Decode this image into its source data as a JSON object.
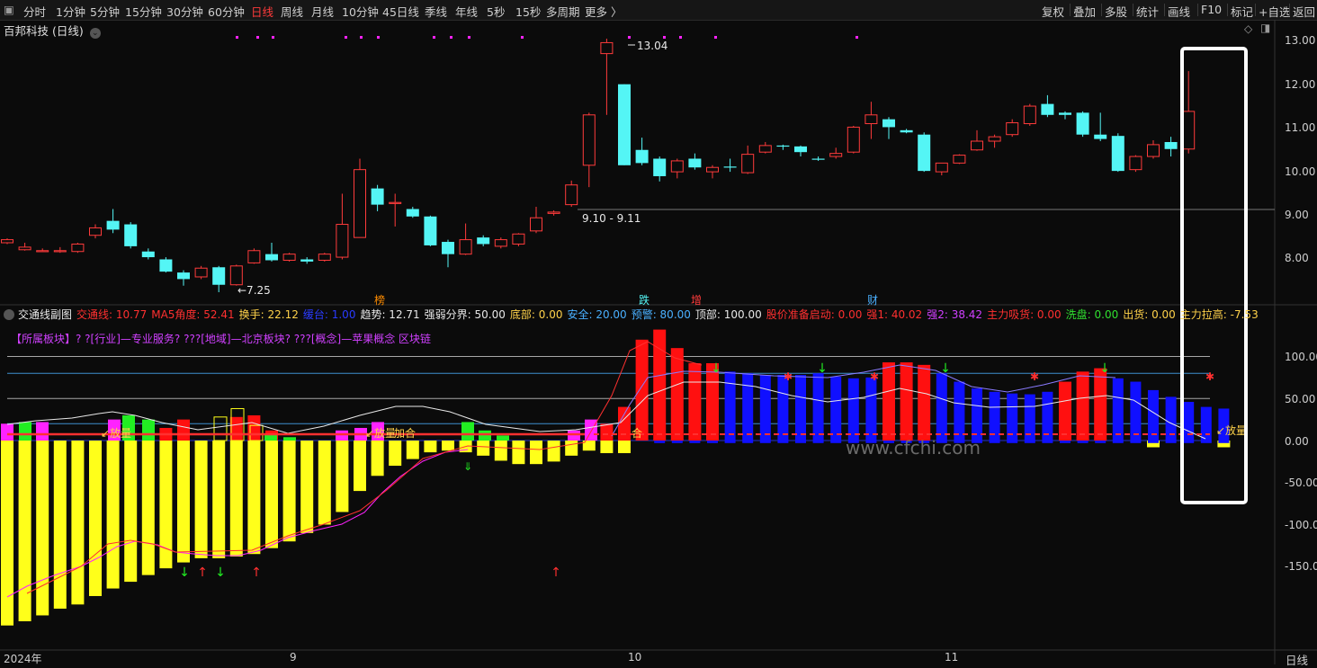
{
  "toolbar": {
    "periods": [
      "分时",
      "1分钟",
      "5分钟",
      "15分钟",
      "30分钟",
      "60分钟",
      "日线",
      "周线",
      "月线",
      "10分钟",
      "45日线",
      "季线",
      "年线",
      "5秒",
      "15秒",
      "多周期",
      "更多 〉"
    ],
    "active_period": "日线",
    "right_buttons": [
      "复权",
      "叠加",
      "多股",
      "统计",
      "画线",
      "F10",
      "标记",
      "+自选",
      "返回"
    ]
  },
  "stock": {
    "title": "百邦科技 (日线)"
  },
  "price_axis": [
    "13.00",
    "12.00",
    "11.00",
    "10.00",
    "9.00",
    "8.00"
  ],
  "annotations": {
    "high": "13.04",
    "low": "7.25",
    "range": "9.10 - 9.11",
    "bottom_markers": [
      "榜",
      "跌",
      "增",
      "财"
    ]
  },
  "indicator": {
    "name": "交通线副图",
    "items": [
      {
        "label": "交通线: 10.77",
        "color": "#ff3030"
      },
      {
        "label": "MA5角度: 52.41",
        "color": "#ff3030"
      },
      {
        "label": "换手: 22.12",
        "color": "#ffd24a"
      },
      {
        "label": "缓台: 1.00",
        "color": "#2a3bff"
      },
      {
        "label": "趋势: 12.71",
        "color": "#e8e8e8"
      },
      {
        "label": "强弱分界: 50.00",
        "color": "#e8e8e8"
      },
      {
        "label": "底部: 0.00",
        "color": "#ffd24a"
      },
      {
        "label": "安全: 20.00",
        "color": "#4ab0ff"
      },
      {
        "label": "预警: 80.00",
        "color": "#4ab0ff"
      },
      {
        "label": "顶部: 100.00",
        "color": "#e8e8e8"
      },
      {
        "label": "股价准备启动: 0.00",
        "color": "#ff3030"
      },
      {
        "label": "强1: 40.02",
        "color": "#ff3030"
      },
      {
        "label": "强2: 38.42",
        "color": "#d040ff"
      },
      {
        "label": "主力吸货: 0.00",
        "color": "#ff3030"
      },
      {
        "label": "洗盘: 0.00",
        "color": "#30e030"
      },
      {
        "label": "出货: 0.00",
        "color": "#ffd24a"
      },
      {
        "label": "主力拉高: -7.53",
        "color": "#ffd24a"
      }
    ],
    "sector_line": "【所属板块】? ?[行业]—专业服务? ???[地域]—北京板块? ???[概念]—苹果概念 区块链",
    "axis": [
      "100.00",
      "50.00",
      "0.00",
      "-50.00",
      "-100.00",
      "-150.00"
    ],
    "labels": {
      "fangliang": "放量",
      "jiahe": "加合",
      "he": "合"
    }
  },
  "date_axis": [
    "2024年",
    "9",
    "10",
    "11"
  ],
  "footer_right": "日线",
  "watermark": "www.cfchi.com",
  "colors": {
    "up": "#ff3b3b",
    "down": "#54f5f5",
    "accent_active": "#ff3b3b",
    "yellow": "#ffff1a",
    "blue": "#1010ff",
    "magenta": "#ff22ff",
    "green": "#22ee22"
  },
  "chart_data": [
    {
      "type": "candlestick",
      "title": "百邦科技 (日线)",
      "ylim": [
        7.2,
        13.4
      ],
      "candles": [
        {
          "o": 8.38,
          "c": 8.45,
          "h": 8.48,
          "l": 8.35
        },
        {
          "o": 8.22,
          "c": 8.28,
          "h": 8.38,
          "l": 8.2
        },
        {
          "o": 8.2,
          "c": 8.2,
          "h": 8.25,
          "l": 8.18
        },
        {
          "o": 8.18,
          "c": 8.2,
          "h": 8.28,
          "l": 8.15
        },
        {
          "o": 8.18,
          "c": 8.35,
          "h": 8.38,
          "l": 8.15
        },
        {
          "o": 8.55,
          "c": 8.72,
          "h": 8.8,
          "l": 8.48
        },
        {
          "o": 8.88,
          "c": 8.68,
          "h": 9.15,
          "l": 8.6
        },
        {
          "o": 8.8,
          "c": 8.3,
          "h": 8.85,
          "l": 8.25
        },
        {
          "o": 8.18,
          "c": 8.05,
          "h": 8.25,
          "l": 8.0
        },
        {
          "o": 8.0,
          "c": 7.72,
          "h": 8.05,
          "l": 7.7
        },
        {
          "o": 7.7,
          "c": 7.55,
          "h": 7.75,
          "l": 7.4
        },
        {
          "o": 7.6,
          "c": 7.8,
          "h": 7.85,
          "l": 7.55
        },
        {
          "o": 7.82,
          "c": 7.42,
          "h": 7.85,
          "l": 7.25
        },
        {
          "o": 7.42,
          "c": 7.85,
          "h": 7.88,
          "l": 7.4
        },
        {
          "o": 7.92,
          "c": 8.2,
          "h": 8.25,
          "l": 7.9
        },
        {
          "o": 8.12,
          "c": 7.98,
          "h": 8.38,
          "l": 7.95
        },
        {
          "o": 7.98,
          "c": 8.12,
          "h": 8.15,
          "l": 7.95
        },
        {
          "o": 8.0,
          "c": 7.95,
          "h": 8.05,
          "l": 7.9
        },
        {
          "o": 7.98,
          "c": 8.12,
          "h": 8.15,
          "l": 7.95
        },
        {
          "o": 8.05,
          "c": 8.8,
          "h": 9.5,
          "l": 8.0
        },
        {
          "o": 8.5,
          "c": 10.05,
          "h": 10.3,
          "l": 8.5
        },
        {
          "o": 9.62,
          "c": 9.25,
          "h": 9.7,
          "l": 9.1
        },
        {
          "o": 9.3,
          "c": 9.3,
          "h": 9.5,
          "l": 8.75
        },
        {
          "o": 9.15,
          "c": 8.98,
          "h": 9.2,
          "l": 8.95
        },
        {
          "o": 8.98,
          "c": 8.32,
          "h": 9.0,
          "l": 8.3
        },
        {
          "o": 8.4,
          "c": 8.12,
          "h": 8.45,
          "l": 7.82
        },
        {
          "o": 8.12,
          "c": 8.45,
          "h": 8.82,
          "l": 8.1
        },
        {
          "o": 8.5,
          "c": 8.35,
          "h": 8.55,
          "l": 8.3
        },
        {
          "o": 8.3,
          "c": 8.45,
          "h": 8.5,
          "l": 8.25
        },
        {
          "o": 8.35,
          "c": 8.58,
          "h": 8.6,
          "l": 8.3
        },
        {
          "o": 8.65,
          "c": 8.95,
          "h": 9.2,
          "l": 8.6
        },
        {
          "o": 9.05,
          "c": 9.08,
          "h": 9.12,
          "l": 9.0
        },
        {
          "o": 9.25,
          "c": 9.7,
          "h": 9.8,
          "l": 9.2
        },
        {
          "o": 10.15,
          "c": 11.3,
          "h": 11.35,
          "l": 9.65
        },
        {
          "o": 12.7,
          "c": 12.95,
          "h": 13.04,
          "l": 11.3
        },
        {
          "o": 12.0,
          "c": 10.15,
          "h": 12.0,
          "l": 10.15
        },
        {
          "o": 10.5,
          "c": 10.2,
          "h": 10.78,
          "l": 10.15
        },
        {
          "o": 10.3,
          "c": 9.9,
          "h": 10.35,
          "l": 9.78
        },
        {
          "o": 10.0,
          "c": 10.25,
          "h": 10.3,
          "l": 9.85
        },
        {
          "o": 10.3,
          "c": 10.1,
          "h": 10.42,
          "l": 10.05
        },
        {
          "o": 10.0,
          "c": 10.1,
          "h": 10.15,
          "l": 9.85
        },
        {
          "o": 10.12,
          "c": 10.1,
          "h": 10.3,
          "l": 10.0
        },
        {
          "o": 9.98,
          "c": 10.4,
          "h": 10.6,
          "l": 9.95
        },
        {
          "o": 10.45,
          "c": 10.6,
          "h": 10.68,
          "l": 10.42
        },
        {
          "o": 10.6,
          "c": 10.58,
          "h": 10.62,
          "l": 10.5
        },
        {
          "o": 10.58,
          "c": 10.45,
          "h": 10.6,
          "l": 10.35
        },
        {
          "o": 10.3,
          "c": 10.28,
          "h": 10.35,
          "l": 10.25
        },
        {
          "o": 10.35,
          "c": 10.42,
          "h": 10.55,
          "l": 10.3
        },
        {
          "o": 10.45,
          "c": 11.02,
          "h": 11.05,
          "l": 10.42
        },
        {
          "o": 11.1,
          "c": 11.3,
          "h": 11.6,
          "l": 10.75
        },
        {
          "o": 11.2,
          "c": 11.02,
          "h": 11.25,
          "l": 10.75
        },
        {
          "o": 10.95,
          "c": 10.9,
          "h": 10.98,
          "l": 10.88
        },
        {
          "o": 10.85,
          "c": 10.02,
          "h": 10.9,
          "l": 10.0
        },
        {
          "o": 10.0,
          "c": 10.2,
          "h": 10.2,
          "l": 9.92
        },
        {
          "o": 10.2,
          "c": 10.38,
          "h": 10.4,
          "l": 10.18
        },
        {
          "o": 10.5,
          "c": 10.7,
          "h": 10.95,
          "l": 10.48
        },
        {
          "o": 10.7,
          "c": 10.8,
          "h": 10.85,
          "l": 10.55
        },
        {
          "o": 10.85,
          "c": 11.12,
          "h": 11.2,
          "l": 10.8
        },
        {
          "o": 11.1,
          "c": 11.5,
          "h": 11.55,
          "l": 11.05
        },
        {
          "o": 11.55,
          "c": 11.3,
          "h": 11.75,
          "l": 11.25
        },
        {
          "o": 11.35,
          "c": 11.3,
          "h": 11.38,
          "l": 11.2
        },
        {
          "o": 11.35,
          "c": 10.85,
          "h": 11.38,
          "l": 10.8
        },
        {
          "o": 10.85,
          "c": 10.75,
          "h": 11.35,
          "l": 10.7
        },
        {
          "o": 10.82,
          "c": 10.02,
          "h": 10.88,
          "l": 10.0
        },
        {
          "o": 10.05,
          "c": 10.35,
          "h": 10.38,
          "l": 10.0
        },
        {
          "o": 10.35,
          "c": 10.62,
          "h": 10.72,
          "l": 10.3
        },
        {
          "o": 10.68,
          "c": 10.52,
          "h": 10.8,
          "l": 10.35
        },
        {
          "o": 10.52,
          "c": 11.38,
          "h": 12.3,
          "l": 10.42
        }
      ]
    },
    {
      "type": "bar",
      "title": "交通线副图",
      "ylim": [
        -170,
        140
      ],
      "hlines": [
        100,
        80,
        50,
        20,
        0
      ],
      "yellow": [
        -220,
        -215,
        -208,
        -200,
        -195,
        -185,
        -176,
        -168,
        -160,
        -152,
        -145,
        -140,
        -140,
        -138,
        -135,
        -128,
        -120,
        -110,
        -100,
        -85,
        -60,
        -42,
        -30,
        -22,
        -14,
        -12,
        -14,
        -18,
        -24,
        -28,
        -28,
        -25,
        -18,
        -12,
        -15,
        -15,
        0,
        0,
        0,
        0,
        0,
        0,
        0,
        0,
        0,
        0,
        0,
        0,
        0,
        0,
        0,
        0,
        0,
        0,
        0,
        0,
        0,
        0,
        0,
        0,
        0,
        0,
        0,
        0,
        0,
        -8,
        0,
        0,
        0,
        -8
      ],
      "red": [
        0,
        0,
        0,
        0,
        0,
        0,
        0,
        0,
        0,
        15,
        25,
        0,
        0,
        28,
        30,
        12,
        0,
        0,
        0,
        0,
        0,
        0,
        0,
        0,
        0,
        0,
        0,
        0,
        0,
        0,
        0,
        0,
        0,
        0,
        20,
        40,
        120,
        132,
        110,
        92,
        92,
        0,
        0,
        0,
        0,
        0,
        0,
        0,
        0,
        0,
        93,
        93,
        90,
        0,
        0,
        0,
        0,
        0,
        0,
        0,
        70,
        82,
        86,
        0,
        0,
        0,
        0,
        0,
        0,
        0
      ],
      "blue": [
        0,
        0,
        0,
        0,
        0,
        0,
        0,
        0,
        0,
        0,
        0,
        0,
        0,
        0,
        0,
        0,
        0,
        0,
        0,
        0,
        0,
        0,
        0,
        0,
        0,
        0,
        0,
        0,
        0,
        0,
        0,
        0,
        0,
        0,
        0,
        0,
        0,
        50,
        72,
        80,
        85,
        82,
        80,
        78,
        78,
        78,
        80,
        76,
        74,
        75,
        80,
        82,
        84,
        80,
        70,
        62,
        58,
        56,
        55,
        58,
        65,
        72,
        76,
        74,
        70,
        60,
        52,
        46,
        40,
        38
      ]
    }
  ]
}
